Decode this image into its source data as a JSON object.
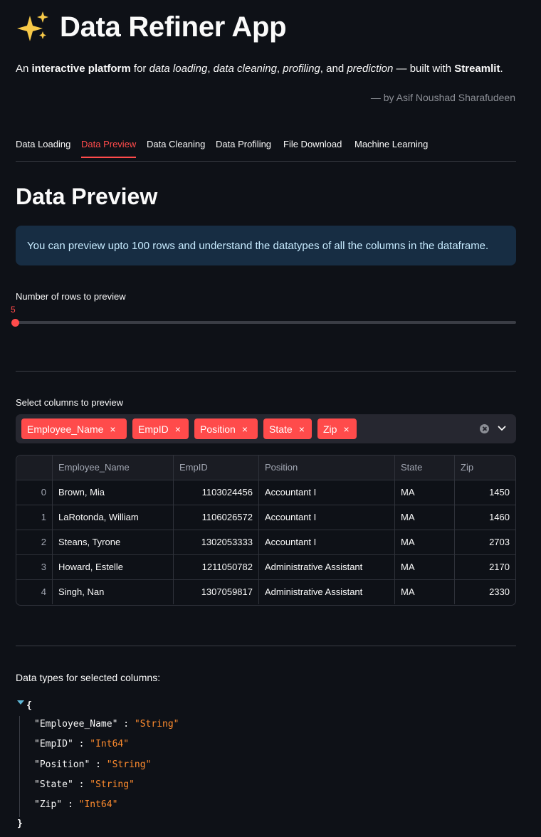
{
  "header": {
    "title": "Data Refiner App",
    "sparkle_icon": "sparkles-icon",
    "intro": {
      "p1": "An ",
      "b1": "interactive platform",
      "p2": " for ",
      "i1": "data loading",
      "p3": ", ",
      "i2": "data cleaning",
      "p4": ", ",
      "i3": "profiling",
      "p5": ", and ",
      "i4": "prediction",
      "p6": " — built with ",
      "b2": "Streamlit",
      "p7": "."
    },
    "author": "— by Asif Noushad Sharafudeen"
  },
  "tabs": [
    {
      "label": "Data Loading",
      "active": false
    },
    {
      "label": "Data Preview",
      "active": true
    },
    {
      "label": "Data Cleaning",
      "active": false
    },
    {
      "label": "Data Profiling",
      "active": false
    },
    {
      "label": "File Download",
      "active": false
    },
    {
      "label": "Machine Learning",
      "active": false
    }
  ],
  "section": {
    "title": "Data Preview",
    "info": "You can preview upto 100 rows and understand the datatypes of all the columns in the dataframe."
  },
  "slider": {
    "label": "Number of rows to preview",
    "value": "5"
  },
  "multiselect": {
    "label": "Select columns to preview",
    "chips": [
      "Employee_Name",
      "EmpID",
      "Position",
      "State",
      "Zip"
    ],
    "remove_glyph": "×",
    "accent": "#ff4b4b"
  },
  "table": {
    "columns": [
      "",
      "Employee_Name",
      "EmpID",
      "Position",
      "State",
      "Zip"
    ],
    "rows": [
      [
        "0",
        "Brown, Mia",
        "1103024456",
        "Accountant I",
        "MA",
        "1450"
      ],
      [
        "1",
        "LaRotonda, William",
        "1106026572",
        "Accountant I",
        "MA",
        "1460"
      ],
      [
        "2",
        "Steans, Tyrone",
        "1302053333",
        "Accountant I",
        "MA",
        "2703"
      ],
      [
        "3",
        "Howard, Estelle",
        "1211050782",
        "Administrative Assistant",
        "MA",
        "2170"
      ],
      [
        "4",
        "Singh, Nan",
        "1307059817",
        "Administrative Assistant",
        "MA",
        "2330"
      ]
    ]
  },
  "dtypes": {
    "label": "Data types for selected columns:",
    "open_brace": "{",
    "close_brace": "}",
    "entries": [
      {
        "key": "\"Employee_Name\"",
        "sep": " : ",
        "value": "\"String\""
      },
      {
        "key": "\"EmpID\"",
        "sep": " : ",
        "value": "\"Int64\""
      },
      {
        "key": "\"Position\"",
        "sep": " : ",
        "value": "\"String\""
      },
      {
        "key": "\"State\"",
        "sep": " : ",
        "value": "\"String\""
      },
      {
        "key": "\"Zip\"",
        "sep": " : ",
        "value": "\"Int64\""
      }
    ],
    "string_color": "#ff8c2e"
  }
}
